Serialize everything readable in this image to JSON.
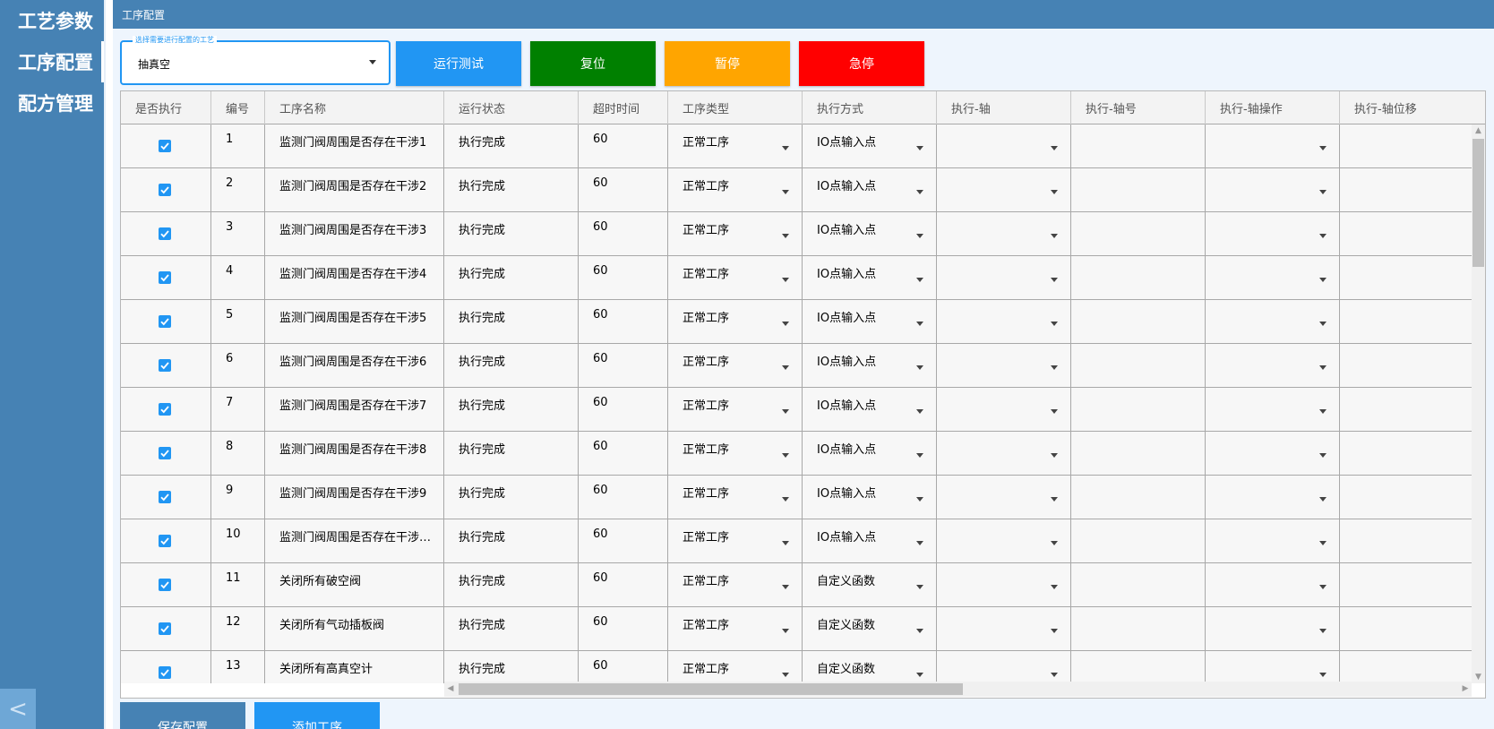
{
  "sidebar": {
    "items": [
      {
        "label": "工艺参数"
      },
      {
        "label": "工序配置"
      },
      {
        "label": "配方管理"
      }
    ],
    "collapse_glyph": "<",
    "active_index": 1
  },
  "header": {
    "title": "工序配置"
  },
  "process_select": {
    "label": "选择需要进行配置的工艺",
    "value": "抽真空",
    "icon": "chevron-down-icon"
  },
  "toolbar": {
    "run_test": "运行测试",
    "reset": "复位",
    "pause": "暂停",
    "emergency_stop": "急停"
  },
  "colors": {
    "sidebar": "#4682b4",
    "run_test": "#2196f3",
    "reset": "#008000",
    "pause": "#ffa500",
    "emergency_stop": "#ff0000",
    "save": "#4682b4",
    "add": "#2196f3"
  },
  "table": {
    "columns": [
      "是否执行",
      "编号",
      "工序名称",
      "运行状态",
      "超时时间",
      "工序类型",
      "执行方式",
      "执行-轴",
      "执行-轴号",
      "执行-轴操作",
      "执行-轴位移"
    ],
    "rows": [
      {
        "checked": true,
        "id": "1",
        "name": "监测门阀周围是否存在干涉1",
        "status": "执行完成",
        "timeout": "60",
        "type": "正常工序",
        "method": "IO点输入点"
      },
      {
        "checked": true,
        "id": "2",
        "name": "监测门阀周围是否存在干涉2",
        "status": "执行完成",
        "timeout": "60",
        "type": "正常工序",
        "method": "IO点输入点"
      },
      {
        "checked": true,
        "id": "3",
        "name": "监测门阀周围是否存在干涉3",
        "status": "执行完成",
        "timeout": "60",
        "type": "正常工序",
        "method": "IO点输入点"
      },
      {
        "checked": true,
        "id": "4",
        "name": "监测门阀周围是否存在干涉4",
        "status": "执行完成",
        "timeout": "60",
        "type": "正常工序",
        "method": "IO点输入点"
      },
      {
        "checked": true,
        "id": "5",
        "name": "监测门阀周围是否存在干涉5",
        "status": "执行完成",
        "timeout": "60",
        "type": "正常工序",
        "method": "IO点输入点"
      },
      {
        "checked": true,
        "id": "6",
        "name": "监测门阀周围是否存在干涉6",
        "status": "执行完成",
        "timeout": "60",
        "type": "正常工序",
        "method": "IO点输入点"
      },
      {
        "checked": true,
        "id": "7",
        "name": "监测门阀周围是否存在干涉7",
        "status": "执行完成",
        "timeout": "60",
        "type": "正常工序",
        "method": "IO点输入点"
      },
      {
        "checked": true,
        "id": "8",
        "name": "监测门阀周围是否存在干涉8",
        "status": "执行完成",
        "timeout": "60",
        "type": "正常工序",
        "method": "IO点输入点"
      },
      {
        "checked": true,
        "id": "9",
        "name": "监测门阀周围是否存在干涉9",
        "status": "执行完成",
        "timeout": "60",
        "type": "正常工序",
        "method": "IO点输入点"
      },
      {
        "checked": true,
        "id": "10",
        "name": "监测门阀周围是否存在干涉…",
        "status": "执行完成",
        "timeout": "60",
        "type": "正常工序",
        "method": "IO点输入点"
      },
      {
        "checked": true,
        "id": "11",
        "name": "关闭所有破空阀",
        "status": "执行完成",
        "timeout": "60",
        "type": "正常工序",
        "method": "自定义函数"
      },
      {
        "checked": true,
        "id": "12",
        "name": "关闭所有气动插板阀",
        "status": "执行完成",
        "timeout": "60",
        "type": "正常工序",
        "method": "自定义函数"
      },
      {
        "checked": true,
        "id": "13",
        "name": "关闭所有高真空计",
        "status": "执行完成",
        "timeout": "60",
        "type": "正常工序",
        "method": "自定义函数"
      }
    ]
  },
  "footer": {
    "save": "保存配置",
    "add": "添加工序"
  }
}
